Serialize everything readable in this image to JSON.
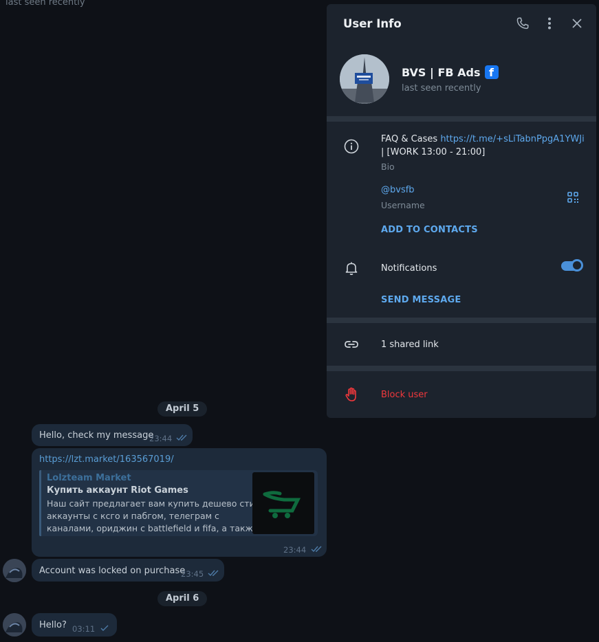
{
  "chat": {
    "top_status": "last seen recently",
    "dates": [
      "April 5",
      "April 6"
    ],
    "messages": [
      {
        "text": "Hello, check my message",
        "time": "23:44"
      },
      {
        "url": "https://lzt.market/163567019/",
        "preview_site": "Lolzteam Market",
        "preview_title": "Купить аккаунт Riot Games",
        "preview_lines": [
          "Наш сайт предлагает вам купить дешево стим",
          "аккаунты с ксго и пабгом, телеграм с",
          "каналами, ориджин с battlefield и fifa, а также..."
        ],
        "time": "23:44"
      },
      {
        "text": "Account was locked on purchase",
        "time": "23:45"
      },
      {
        "text": "Hello?",
        "time": "03:11"
      }
    ]
  },
  "panel": {
    "title": "User Info",
    "icons": {
      "call": "phone-icon",
      "more": "more-vertical-icon",
      "close": "close-icon"
    },
    "name": "BVS | FB Ads",
    "status": "last seen recently",
    "bio_prefix": "FAQ & Cases ",
    "bio_link": "https://t.me/+sLiTabnPpgA1YWJi",
    "bio_suffix": " | [WORK 13:00 - 21:00]",
    "bio_label": "Bio",
    "username": "@bvsfb",
    "username_label": "Username",
    "add_contacts": "ADD TO CONTACTS",
    "notifications": "Notifications",
    "notifications_on": true,
    "send_message": "SEND MESSAGE",
    "shared_links": "1 shared link",
    "block_user": "Block user",
    "colors": {
      "accent": "#5ea9ee",
      "danger": "#f0383c",
      "panel": "#1c232d"
    }
  }
}
